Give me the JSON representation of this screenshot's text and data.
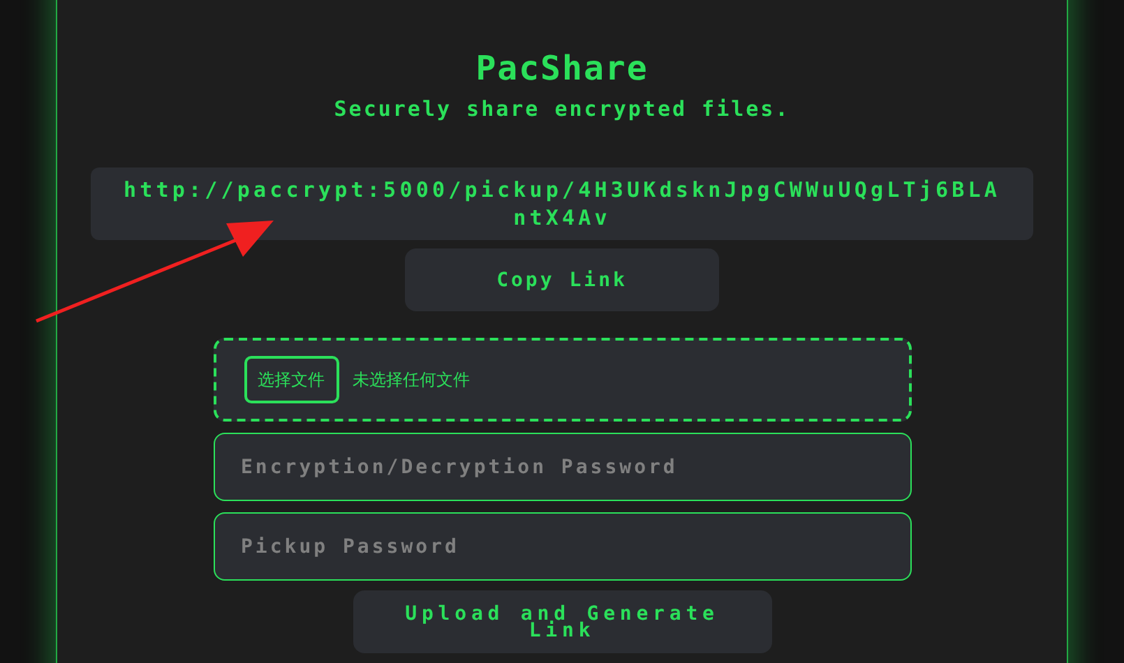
{
  "app": {
    "title": "PacShare",
    "subtitle": "Securely share encrypted files."
  },
  "link": {
    "url": "http://paccrypt:5000/pickup/4H3UKdsknJpgCWWuUQgLTj6BLAntX4Av"
  },
  "copy_button": "Copy Link",
  "file_picker": {
    "button": "选择文件",
    "status": "未选择任何文件"
  },
  "fields": [
    {
      "placeholder": "Encryption/Decryption Password"
    },
    {
      "placeholder": "Pickup Password"
    }
  ],
  "upload_button": "Upload and Generate Link"
}
